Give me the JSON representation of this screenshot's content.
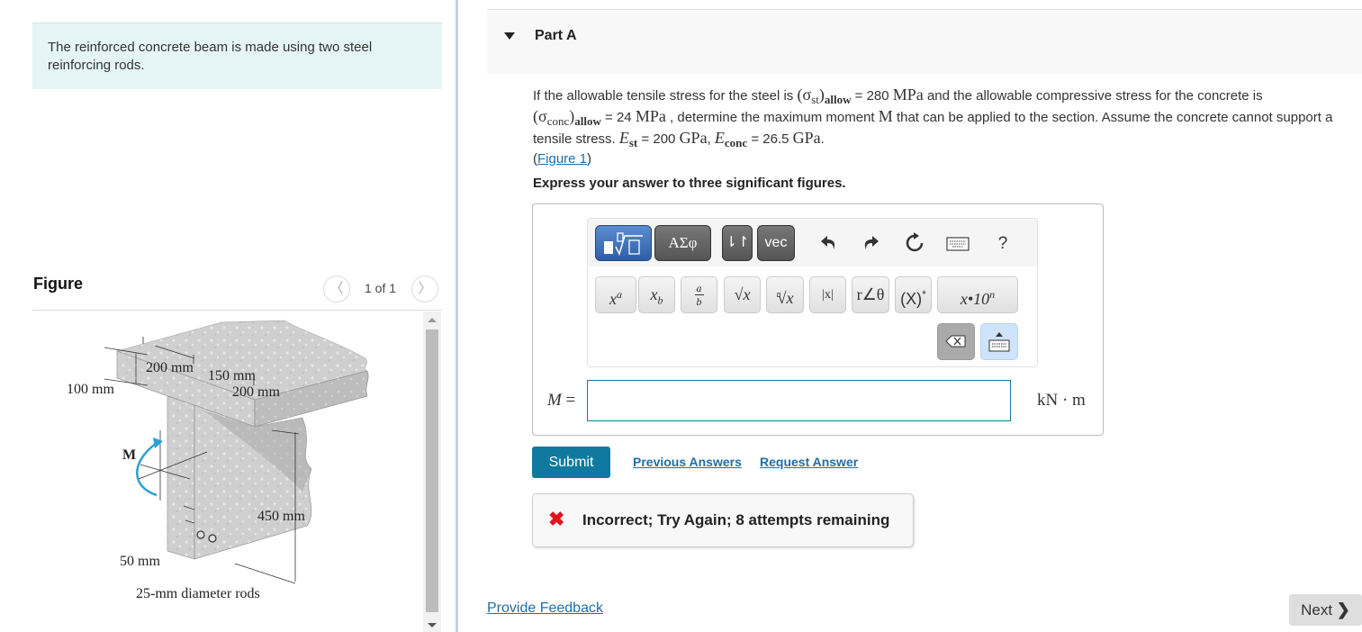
{
  "intro": {
    "text": "The reinforced concrete beam is made using two steel reinforcing rods."
  },
  "figure_panel": {
    "title": "Figure",
    "counter": "1 of 1",
    "prev_icon": "chevron-left-icon",
    "next_icon": "chevron-right-icon",
    "labels": {
      "flange_width_left": "200 mm",
      "web_width": "150 mm",
      "flange_width_right": "200 mm",
      "flange_thickness": "100 mm",
      "web_depth": "450 mm",
      "rod_cover": "50 mm",
      "rod_note": "25-mm diameter rods",
      "moment": "M"
    }
  },
  "part": {
    "title": "Part A",
    "question": {
      "t1": "If the allowable tensile stress for the steel is ",
      "sigma_st": "(σ",
      "st": "st",
      "close": ")",
      "allow": "allow",
      "eq_280": " = 280 ",
      "mpa": "MPa",
      "t2": " and the allowable compressive stress for the concrete is ",
      "sigma_conc": "(σ",
      "conc": "conc",
      "eq_24": " = 24 ",
      "t3": " , determine the maximum moment ",
      "M": "M",
      "t4": " that can be applied to the section. Assume the concrete cannot support a tensile stress. ",
      "E": "E",
      "eq_200": " = 200 ",
      "gpa": "GPa",
      "comma": ", ",
      "eq_265": " = 26.5 ",
      "period": ".",
      "fig_open": "(",
      "fig_link": "Figure 1",
      "fig_close": ")"
    },
    "instruction": "Express your answer to three significant figures."
  },
  "editor": {
    "toolbar": {
      "templates_icon": "template-root-icon",
      "greek": "ΑΣφ",
      "arrows": "⇂↾",
      "vec": "vec",
      "undo_icon": "undo-icon",
      "redo_icon": "redo-icon",
      "reset_icon": "reset-icon",
      "keyboard_icon": "keyboard-icon",
      "help": "?"
    },
    "keys": {
      "sup_base": "x",
      "sup_exp": "a",
      "sub_base": "x",
      "sub_idx": "b",
      "frac_num": "a",
      "frac_den": "b",
      "sqrt": "√x",
      "nroot_n": "n",
      "nroot": "√x",
      "abs": "|x|",
      "angle": "r∠θ",
      "conj": "(X)",
      "conj_star": "*",
      "sci": "x•10",
      "sci_exp": "n"
    },
    "backspace_icon": "backspace-icon",
    "keyboard_toggle_icon": "keyboard-toggle-icon"
  },
  "answer": {
    "variable": "M",
    "equals": " =",
    "value": "",
    "units": "kN · m"
  },
  "actions": {
    "submit": "Submit",
    "previous_answers": "Previous Answers",
    "request_answer": "Request Answer"
  },
  "feedback": {
    "icon": "✖",
    "message": "Incorrect; Try Again; 8 attempts remaining"
  },
  "footer": {
    "provide_feedback": "Provide Feedback",
    "next": "Next",
    "next_icon": "❯"
  },
  "colors": {
    "intro_bg": "#e5f5f6",
    "link": "#1e6fa7",
    "submit_bg": "#0f7a9d",
    "error": "#e0141e",
    "active_tool": "#2d5fa8"
  }
}
